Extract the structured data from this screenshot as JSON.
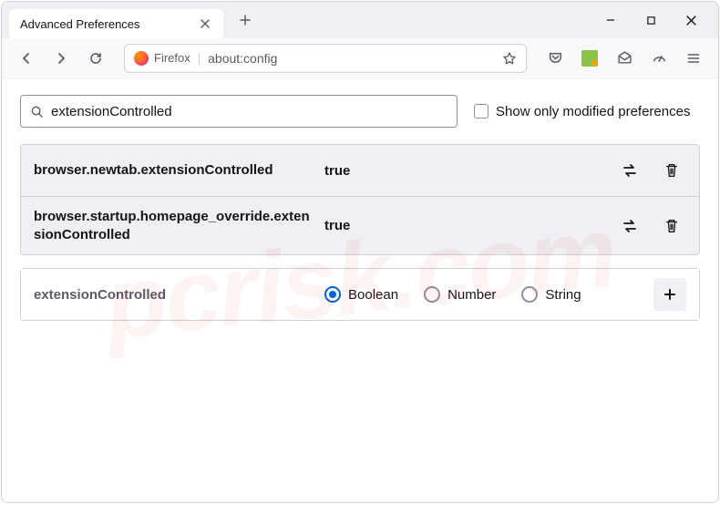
{
  "window": {
    "tab_title": "Advanced Preferences"
  },
  "toolbar": {
    "identity_label": "Firefox",
    "url": "about:config"
  },
  "config": {
    "search_value": "extensionControlled",
    "show_modified_label": "Show only modified preferences",
    "prefs": [
      {
        "name": "browser.newtab.extensionControlled",
        "value": "true"
      },
      {
        "name": "browser.startup.homepage_override.extensionControlled",
        "value": "true"
      }
    ],
    "new_pref": {
      "name": "extensionControlled",
      "types": {
        "boolean": "Boolean",
        "number": "Number",
        "string": "String"
      },
      "selected": "boolean"
    }
  },
  "watermark": "pcrisk.com"
}
